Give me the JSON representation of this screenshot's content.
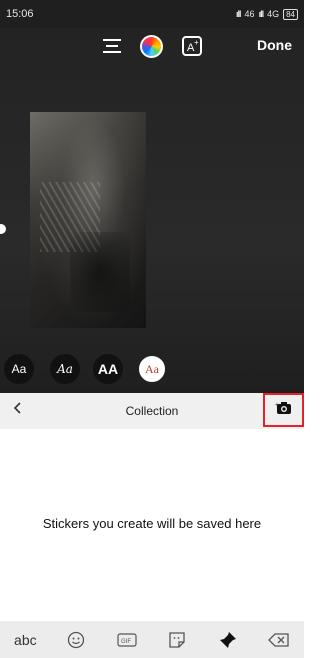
{
  "status": {
    "time": "15:06",
    "signal": "46",
    "network": "4G",
    "battery": "84"
  },
  "toolbar": {
    "done_label": "Done"
  },
  "fonts": [
    {
      "label": "Aa"
    },
    {
      "label": "Aa"
    },
    {
      "label": "AA"
    },
    {
      "label": "Aa"
    }
  ],
  "sticker_panel": {
    "title": "Collection",
    "empty_message": "Stickers you create will be saved here"
  },
  "keyboard": {
    "abc_label": "abc"
  },
  "colors": {
    "highlight": "#e8202a",
    "panel_bg": "#f0f0f0"
  },
  "icons": [
    "align-icon",
    "color-wheel-icon",
    "text-effect-icon",
    "back-icon",
    "add-sticker-camera-icon",
    "emoji-icon",
    "gif-icon",
    "sticker-icon",
    "pin-icon",
    "backspace-icon"
  ]
}
